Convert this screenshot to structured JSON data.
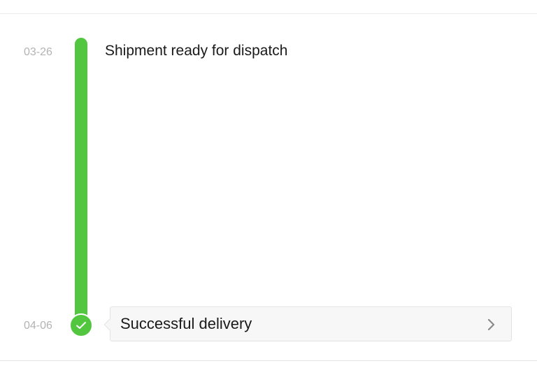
{
  "timeline": {
    "events": [
      {
        "date": "03-26",
        "text": "Shipment ready for dispatch"
      },
      {
        "date": "04-06",
        "text": "Successful delivery"
      }
    ]
  },
  "icons": {
    "check": "checkmark-icon",
    "chevron": "chevron-right-icon"
  },
  "colors": {
    "accent": "#52c63f",
    "date_text": "#b3b3b3",
    "primary_text": "#1a1a1a",
    "card_background": "#f7f7f7"
  }
}
